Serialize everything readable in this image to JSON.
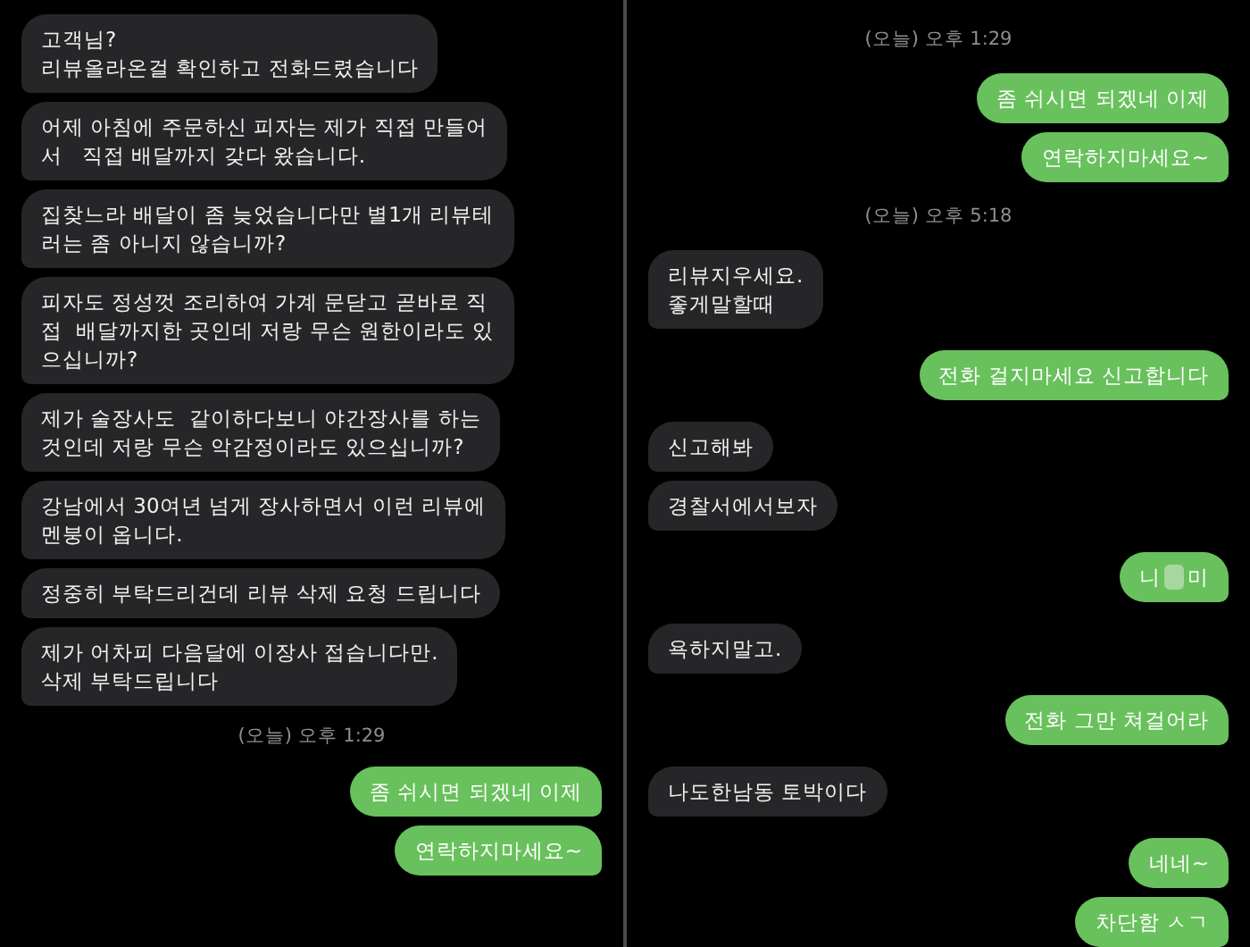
{
  "panels": [
    {
      "messages": [
        {
          "kind": "incoming",
          "text": "고객님?\n리뷰올라온걸 확인하고 전화드렸습니다"
        },
        {
          "kind": "incoming",
          "text": "어제 아침에 주문하신 피자는 제가 직접 만들어\n서   직접 배달까지 갖다 왔습니다."
        },
        {
          "kind": "incoming",
          "text": "집찾느라 배달이 좀 늦었습니다만 별1개 리뷰테\n러는 좀 아니지 않습니까?"
        },
        {
          "kind": "incoming",
          "text": "피자도 정성껏 조리하여 가계 문닫고 곧바로 직\n접  배달까지한 곳인데 저랑 무슨 원한이라도 있\n으십니까?"
        },
        {
          "kind": "incoming",
          "text": "제가 술장사도  같이하다보니 야간장사를 하는\n것인데 저랑 무슨 악감정이라도 있으십니까?"
        },
        {
          "kind": "incoming",
          "text": "강남에서 30여년 넘게 장사하면서 이런 리뷰에\n멘붕이 옵니다."
        },
        {
          "kind": "incoming",
          "text": "정중히 부탁드리건데 리뷰 삭제 요청 드립니다"
        },
        {
          "kind": "incoming",
          "text": "제가 어차피 다음달에 이장사 접습니다만.\n삭제 부탁드립니다"
        },
        {
          "kind": "timestamp",
          "text": "(오늘) 오후 1:29"
        },
        {
          "kind": "outgoing",
          "text": "좀 쉬시면 되겠네 이제"
        },
        {
          "kind": "outgoing",
          "text": "연락하지마세요~"
        }
      ]
    },
    {
      "messages": [
        {
          "kind": "timestamp",
          "text": "(오늘) 오후 1:29"
        },
        {
          "kind": "outgoing",
          "text": "좀 쉬시면 되겠네 이제"
        },
        {
          "kind": "outgoing",
          "text": "연락하지마세요~"
        },
        {
          "kind": "timestamp",
          "text": "(오늘) 오후 5:18"
        },
        {
          "kind": "incoming",
          "text": "리뷰지우세요.\n좋게말할때"
        },
        {
          "kind": "outgoing",
          "text": "전화 걸지마세요 신고합니다"
        },
        {
          "kind": "incoming",
          "text": "신고해봐"
        },
        {
          "kind": "incoming",
          "text": "경찰서에서보자"
        },
        {
          "kind": "censored",
          "parts": [
            "니",
            "미"
          ]
        },
        {
          "kind": "incoming",
          "text": "욕하지말고."
        },
        {
          "kind": "outgoing",
          "text": "전화 그만 쳐걸어라"
        },
        {
          "kind": "incoming",
          "text": "나도한남동 토박이다"
        },
        {
          "kind": "outgoing",
          "text": "네네~"
        },
        {
          "kind": "outgoing",
          "text": "차단함 ㅅㄱ"
        }
      ]
    }
  ]
}
